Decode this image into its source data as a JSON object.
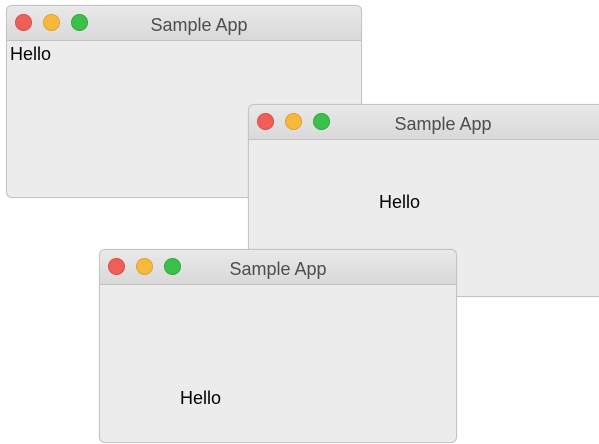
{
  "windows": [
    {
      "title": "Sample App",
      "label": "Hello",
      "controls": [
        "close",
        "minimize",
        "zoom"
      ]
    },
    {
      "title": "Sample App",
      "label": "Hello",
      "controls": [
        "close",
        "minimize",
        "zoom"
      ]
    },
    {
      "title": "Sample App",
      "label": "Hello",
      "controls": [
        "close",
        "minimize",
        "zoom"
      ]
    }
  ],
  "colors": {
    "close": "#ef5e57",
    "minimize": "#f6b93b",
    "zoom": "#3bc14a",
    "window_bg": "#ececec"
  }
}
